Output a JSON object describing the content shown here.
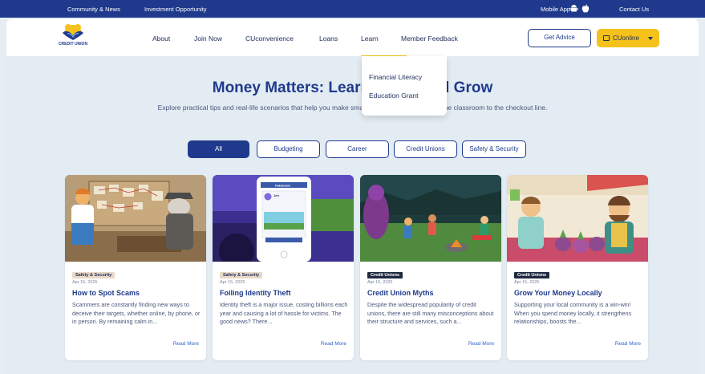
{
  "topbar": {
    "community": "Community & News",
    "investment": "Investment Opportunity",
    "mobile_app": "Mobile App",
    "contact": "Contact Us"
  },
  "header": {
    "logo_text": "CREDIT UNION",
    "nav": {
      "about": "About",
      "join": "Join Now",
      "cuconvenience": "CUconvenience",
      "loans": "Loans",
      "learn": "Learn",
      "feedback": "Member Feedback"
    },
    "advice_button": "Get Advice",
    "cuonline_button": "CUonline"
  },
  "dropdown": {
    "items": [
      "Financial Literacy",
      "Education Grant"
    ]
  },
  "hero": {
    "title": "Money Matters: Learn, Save, and Grow",
    "subtitle": "Explore practical tips and real-life scenarios that help you make smart financial decisions from the classroom to the checkout line."
  },
  "filters": [
    "All",
    "Budgeting",
    "Career",
    "Credit Unions",
    "Safety & Security"
  ],
  "cards": [
    {
      "category": "Safety & Security",
      "date": "Apr 15, 2025",
      "title": "How to Spot Scams",
      "description": "Scammers are constantly finding new ways to deceive their targets, whether online, by phone, or in person. By remaining calm in...",
      "read_more": "Read More"
    },
    {
      "category": "Safety & Security",
      "date": "Apr 15, 2025",
      "title": "Foiling Identity Theft",
      "description": "Identity theft is a major issue, costing billions each year and causing a lot of hassle for victims. The good news? There...",
      "read_more": "Read More"
    },
    {
      "category": "Credit Unions",
      "date": "Apr 15, 2025",
      "title": "Credit Union Myths",
      "description": "Despite the widespread popularity of credit unions, there are still many misconceptions about their structure and services, such a...",
      "read_more": "Read More"
    },
    {
      "category": "Credit Unions",
      "date": "Apr 15, 2025",
      "title": "Grow Your Money Locally",
      "description": "Supporting your local community is a win-win! When you spend money locally, it strengthens relationships, boosts the...",
      "read_more": "Read More"
    }
  ],
  "phone_mock": {
    "app_name": "Fakebook",
    "user": "Jen"
  },
  "colors": {
    "brand_navy": "#1f3a8c",
    "accent_yellow": "#f4c21b",
    "page_bg": "#e3ecf3",
    "link_blue": "#2f63c9"
  }
}
